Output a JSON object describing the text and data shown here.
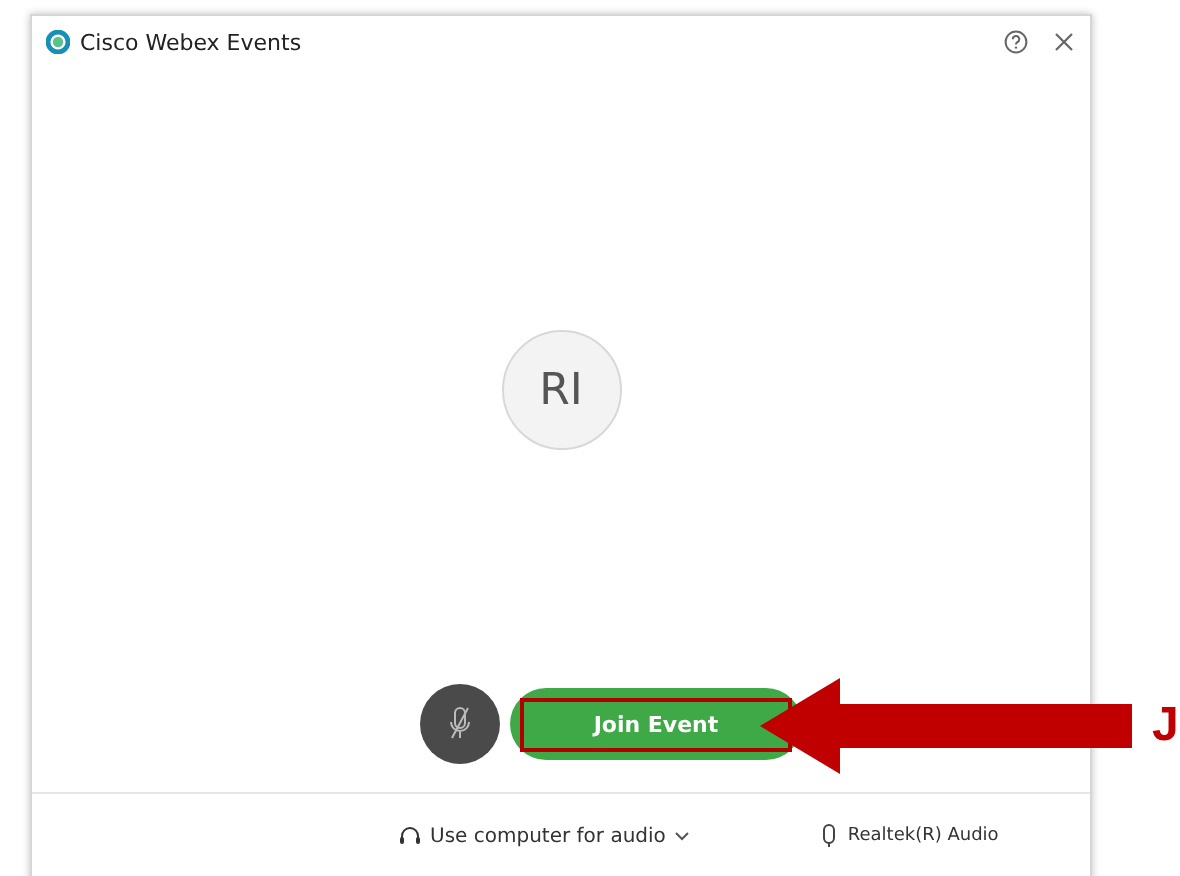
{
  "window": {
    "title": "Cisco Webex Events"
  },
  "avatar": {
    "initials": "RI"
  },
  "mute_button": {
    "muted": true
  },
  "join_button": {
    "label": "Join Event",
    "highlighted": true
  },
  "audio": {
    "connection": "Use computer for audio",
    "microphone": "Realtek(R) Audio"
  },
  "annotation": {
    "label": "J"
  }
}
